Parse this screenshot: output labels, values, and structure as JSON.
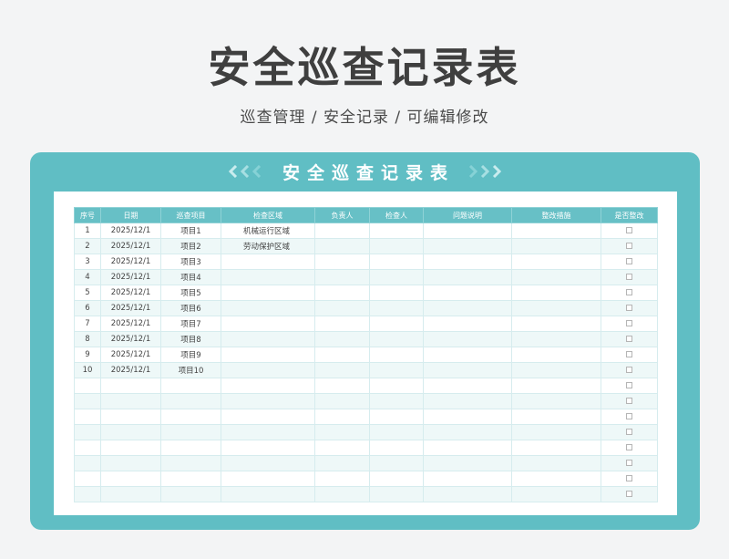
{
  "header": {
    "title": "安全巡查记录表",
    "subtitle": "巡查管理 / 安全记录 /  可编辑修改"
  },
  "card": {
    "title": "安全巡查记录表"
  },
  "table": {
    "columns": [
      "序号",
      "日期",
      "巡查项目",
      "检查区域",
      "负责人",
      "检查人",
      "问题说明",
      "整改措施",
      "是否整改"
    ],
    "rows": [
      {
        "no": "1",
        "date": "2025/12/1",
        "item": "项目1",
        "area": "机械运行区域",
        "owner": "",
        "inspector": "",
        "issue": "",
        "measure": "",
        "rectified": false
      },
      {
        "no": "2",
        "date": "2025/12/1",
        "item": "项目2",
        "area": "劳动保护区域",
        "owner": "",
        "inspector": "",
        "issue": "",
        "measure": "",
        "rectified": false
      },
      {
        "no": "3",
        "date": "2025/12/1",
        "item": "项目3",
        "area": "",
        "owner": "",
        "inspector": "",
        "issue": "",
        "measure": "",
        "rectified": false
      },
      {
        "no": "4",
        "date": "2025/12/1",
        "item": "项目4",
        "area": "",
        "owner": "",
        "inspector": "",
        "issue": "",
        "measure": "",
        "rectified": false
      },
      {
        "no": "5",
        "date": "2025/12/1",
        "item": "项目5",
        "area": "",
        "owner": "",
        "inspector": "",
        "issue": "",
        "measure": "",
        "rectified": false
      },
      {
        "no": "6",
        "date": "2025/12/1",
        "item": "项目6",
        "area": "",
        "owner": "",
        "inspector": "",
        "issue": "",
        "measure": "",
        "rectified": false
      },
      {
        "no": "7",
        "date": "2025/12/1",
        "item": "项目7",
        "area": "",
        "owner": "",
        "inspector": "",
        "issue": "",
        "measure": "",
        "rectified": false
      },
      {
        "no": "8",
        "date": "2025/12/1",
        "item": "项目8",
        "area": "",
        "owner": "",
        "inspector": "",
        "issue": "",
        "measure": "",
        "rectified": false
      },
      {
        "no": "9",
        "date": "2025/12/1",
        "item": "项目9",
        "area": "",
        "owner": "",
        "inspector": "",
        "issue": "",
        "measure": "",
        "rectified": false
      },
      {
        "no": "10",
        "date": "2025/12/1",
        "item": "项目10",
        "area": "",
        "owner": "",
        "inspector": "",
        "issue": "",
        "measure": "",
        "rectified": false
      },
      {
        "no": "",
        "date": "",
        "item": "",
        "area": "",
        "owner": "",
        "inspector": "",
        "issue": "",
        "measure": "",
        "rectified": false
      },
      {
        "no": "",
        "date": "",
        "item": "",
        "area": "",
        "owner": "",
        "inspector": "",
        "issue": "",
        "measure": "",
        "rectified": false
      },
      {
        "no": "",
        "date": "",
        "item": "",
        "area": "",
        "owner": "",
        "inspector": "",
        "issue": "",
        "measure": "",
        "rectified": false
      },
      {
        "no": "",
        "date": "",
        "item": "",
        "area": "",
        "owner": "",
        "inspector": "",
        "issue": "",
        "measure": "",
        "rectified": false
      },
      {
        "no": "",
        "date": "",
        "item": "",
        "area": "",
        "owner": "",
        "inspector": "",
        "issue": "",
        "measure": "",
        "rectified": false
      },
      {
        "no": "",
        "date": "",
        "item": "",
        "area": "",
        "owner": "",
        "inspector": "",
        "issue": "",
        "measure": "",
        "rectified": false
      },
      {
        "no": "",
        "date": "",
        "item": "",
        "area": "",
        "owner": "",
        "inspector": "",
        "issue": "",
        "measure": "",
        "rectified": false
      },
      {
        "no": "",
        "date": "",
        "item": "",
        "area": "",
        "owner": "",
        "inspector": "",
        "issue": "",
        "measure": "",
        "rectified": false
      }
    ]
  },
  "colors": {
    "accent": "#60bec4",
    "header_cell": "#67c0c6",
    "stripe": "#eef8f8",
    "title_text": "#3f3f3f"
  }
}
